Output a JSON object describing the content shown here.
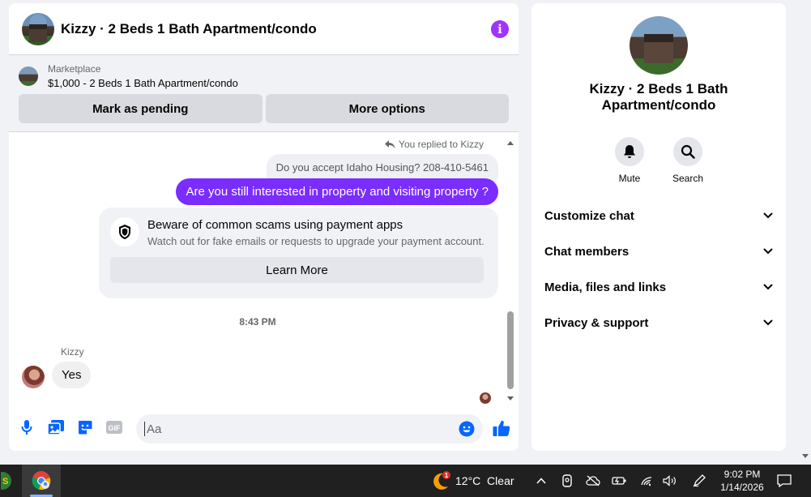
{
  "chat": {
    "title": "Kizzy · 2 Beds 1 Bath Apartment/condo",
    "marketplace": {
      "label": "Marketplace",
      "listing": "$1,000 - 2 Beds 1 Bath Apartment/condo",
      "mark_pending": "Mark as pending",
      "more_options": "More options"
    },
    "replied_note": "You replied to Kizzy",
    "quoted_message": "Do you accept Idaho Housing? 208-410-5461",
    "my_message": "Are you still interested in property and visiting property ?",
    "scam_card": {
      "title": "Beware of common scams using payment apps",
      "subtitle": "Watch out for fake emails or requests to upgrade your payment account.",
      "button": "Learn More"
    },
    "timestamp": "8:43 PM",
    "sender": "Kizzy",
    "their_message": "Yes",
    "composer": {
      "placeholder": "Aa"
    }
  },
  "info_panel": {
    "title": "Kizzy · 2 Beds 1 Bath Apartment/condo",
    "actions": [
      {
        "label": "Mute",
        "icon": "bell-icon"
      },
      {
        "label": "Search",
        "icon": "search-icon"
      }
    ],
    "sections": [
      "Customize chat",
      "Chat members",
      "Media, files and links",
      "Privacy & support"
    ]
  },
  "taskbar": {
    "weather": "12°C  Clear",
    "weather_badge": "1",
    "time": "9:02 PM",
    "date": "1/14/2026"
  },
  "colors": {
    "accent": "#7b2cff",
    "info_icon": "#a033ff",
    "messenger_blue": "#0866ff",
    "taskbar": "#202020"
  }
}
